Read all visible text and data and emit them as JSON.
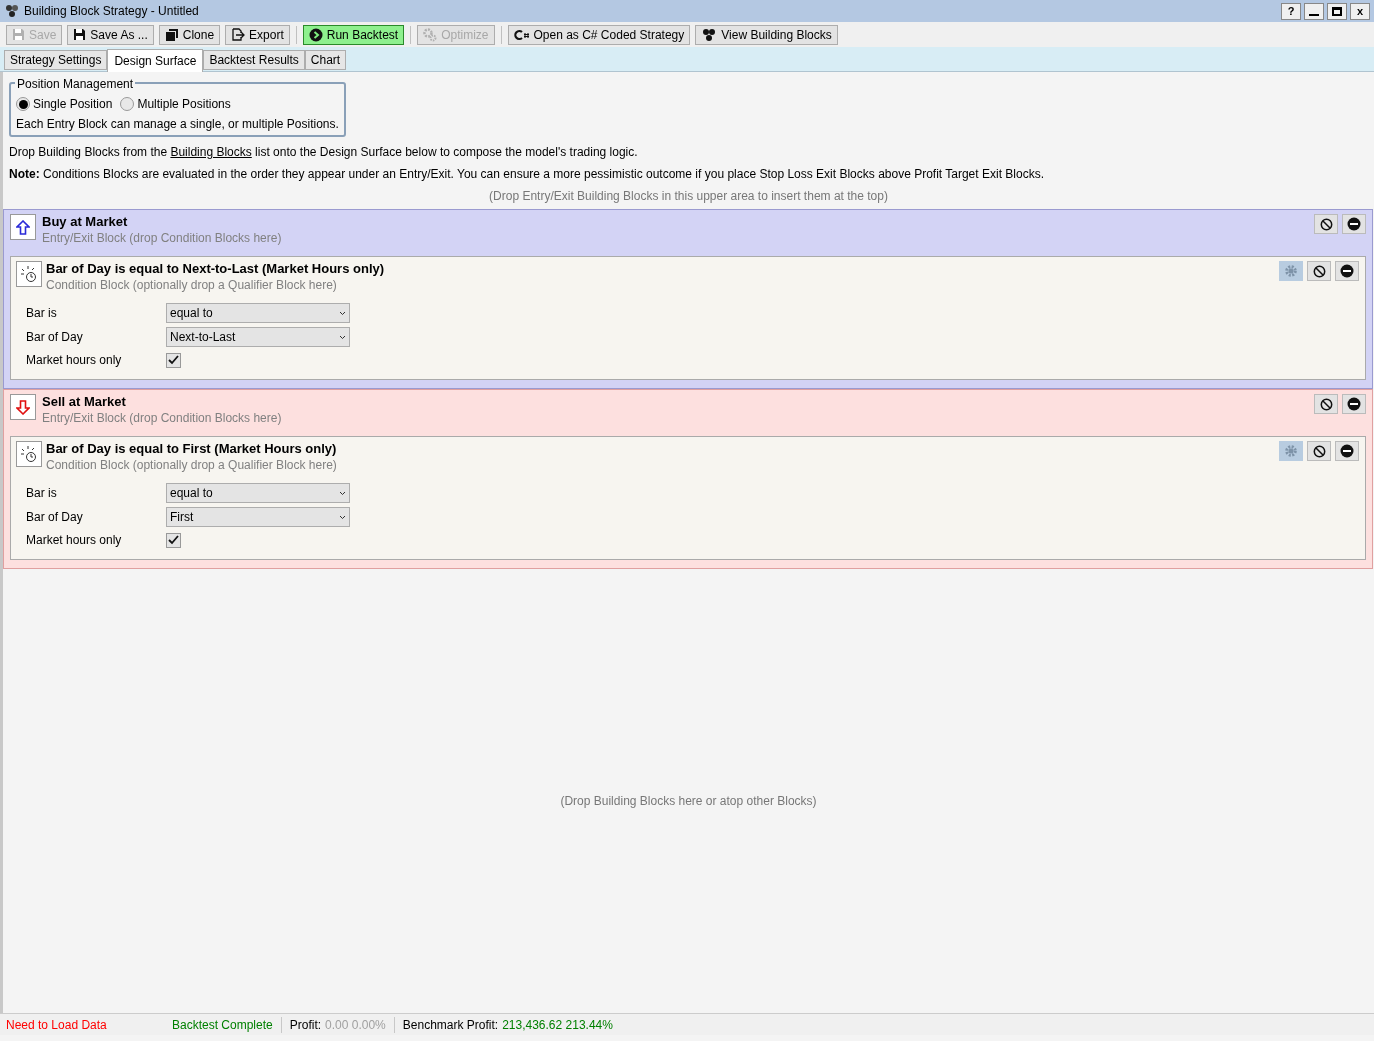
{
  "window": {
    "title": "Building Block Strategy - Untitled",
    "help": "?",
    "close": "x"
  },
  "toolbar": [
    {
      "kind": "save",
      "label": "Save",
      "disabled": true,
      "highlighted": false
    },
    {
      "kind": "save",
      "label": "Save As ...",
      "disabled": false,
      "highlighted": false
    },
    {
      "kind": "clone",
      "label": "Clone",
      "disabled": false,
      "highlighted": false
    },
    {
      "kind": "export",
      "label": "Export",
      "disabled": false,
      "highlighted": false
    },
    {
      "kind": "separator"
    },
    {
      "kind": "run",
      "label": "Run Backtest",
      "disabled": false,
      "highlighted": true
    },
    {
      "kind": "separator"
    },
    {
      "kind": "optimize",
      "label": "Optimize",
      "disabled": true,
      "highlighted": false
    },
    {
      "kind": "separator"
    },
    {
      "kind": "code",
      "label": "Open as C# Coded Strategy",
      "disabled": false,
      "highlighted": false
    },
    {
      "kind": "blocks",
      "label": "View Building Blocks",
      "disabled": false,
      "highlighted": false
    }
  ],
  "tabs": [
    {
      "label": "Strategy Settings",
      "selected": false
    },
    {
      "label": "Design Surface",
      "selected": true
    },
    {
      "label": "Backtest Results",
      "selected": false
    },
    {
      "label": "Chart",
      "selected": false
    }
  ],
  "position_management": {
    "title": "Position Management",
    "options": [
      {
        "label": "Single Position",
        "selected": true
      },
      {
        "label": "Multiple Positions",
        "selected": false
      }
    ],
    "note": "Each Entry Block can manage a single, or multiple Positions."
  },
  "intro": {
    "before": "Drop Building Blocks from the ",
    "link": "Building Blocks",
    "after": " list onto the Design Surface below to compose the model's trading logic."
  },
  "note": "**Note:** Conditions Blocks are evaluated in the order they appear under an Entry/Exit. You can ensure a more pessimistic outcome if you place Stop Loss Exit Blocks above Profit Target Exit Blocks.",
  "top_hint": "(Drop Entry/Exit Building Blocks in this upper area to insert them at the top)",
  "blocks": [
    {
      "kind": "buy",
      "title": "Buy at Market",
      "subtitle": "Entry/Exit Block (drop Condition Blocks here)",
      "conditions": [
        {
          "title": "Bar of Day is equal to Next-to-Last (Market Hours only)",
          "subtitle": "Condition Block (optionally drop a Qualifier Block here)",
          "params": [
            {
              "kind": "dropdown",
              "label": "Bar is",
              "value": "equal to"
            },
            {
              "kind": "dropdown",
              "label": "Bar of Day",
              "value": "Next-to-Last"
            },
            {
              "kind": "checkbox",
              "label": "Market hours only",
              "checked": true
            }
          ]
        }
      ]
    },
    {
      "kind": "sell",
      "title": "Sell at Market",
      "subtitle": "Entry/Exit Block (drop Condition Blocks here)",
      "conditions": [
        {
          "title": "Bar of Day is equal to First (Market Hours only)",
          "subtitle": "Condition Block (optionally drop a Qualifier Block here)",
          "params": [
            {
              "kind": "dropdown",
              "label": "Bar is",
              "value": "equal to"
            },
            {
              "kind": "dropdown",
              "label": "Bar of Day",
              "value": "First"
            },
            {
              "kind": "checkbox",
              "label": "Market hours only",
              "checked": true
            }
          ]
        }
      ]
    }
  ],
  "bottom_hint": "(Drop Building Blocks here or atop other Blocks)",
  "status_bar": [
    {
      "kind": "text",
      "text": "Need to Load Data",
      "color": "#ff0000"
    },
    {
      "kind": "text",
      "text": "Backtest Complete",
      "color": "#008000"
    },
    {
      "kind": "metric",
      "label": "Profit:",
      "value": "0.00 0.00%",
      "color": "#a0a0a0"
    },
    {
      "kind": "metric",
      "label": "Benchmark Profit:",
      "value": "213,436.62 213.44%",
      "color": "#008000"
    }
  ]
}
